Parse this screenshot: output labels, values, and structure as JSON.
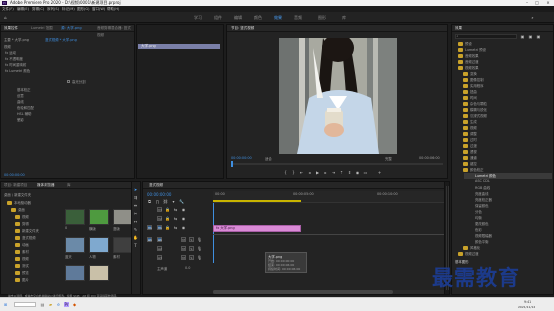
{
  "title_bar": {
    "title": "Adobe Premiere Pro 2020 - D:\\视频\\0001\\新建项目.prproj"
  },
  "menu": [
    "文件(F)",
    "编辑(E)",
    "剪辑(C)",
    "序列(S)",
    "标记(M)",
    "图形(G)",
    "窗口(W)",
    "帮助(H)"
  ],
  "workspaces": [
    {
      "label": "学习"
    },
    {
      "label": "组件"
    },
    {
      "label": "编辑",
      "active": true
    },
    {
      "label": "颜色"
    },
    {
      "label": "效果"
    },
    {
      "label": "音频"
    },
    {
      "label": "图形"
    },
    {
      "label": "库"
    }
  ],
  "effect_controls": {
    "tabs": [
      "效果控件",
      "Lumetri 范围",
      "源: 大学.png",
      "音频剪辑混合器: 竖式视频"
    ],
    "source_line": "主要 * 大学.png",
    "sequence_line": "竖式视频 * 大学.png",
    "section": "视频",
    "items": [
      "fx 运动",
      "fx 不透明度",
      "fx 时间重映射",
      "fx Lumetri 颜色",
      "基本校正",
      "创意",
      "曲线",
      "色轮和匹配",
      "HSL 辅助",
      "晕影"
    ],
    "checkbox_label": "高光分割",
    "time": "00:00:00:00"
  },
  "clip_chip": {
    "label": "大学.png"
  },
  "program": {
    "tab": "节目: 竖式视频",
    "timecode_left": "00:00:00:00",
    "fit": "适合",
    "quality": "完整",
    "timecode_right": "00:00:06:00"
  },
  "project": {
    "tabs": [
      "项目: 新建项目",
      "媒体浏览器",
      "库"
    ],
    "path": "桌面 \\ 新建文件夹",
    "tree": [
      "本地驱动器",
      "桌面",
      "视频",
      "剪辑",
      "新建文件夹",
      "竖式视频",
      "动画",
      "素材",
      "视频",
      "测试",
      "预览",
      "图片"
    ],
    "thumb_labels": [
      "0",
      "横版",
      "竖版",
      "蓝天",
      "人物",
      "素材"
    ]
  },
  "timeline": {
    "tab": "竖式视频",
    "timecode": "00:00:00:00",
    "ruler": [
      "00:00",
      "00:00:05:00",
      "00:00:10:00"
    ],
    "tracks": [
      "V3",
      "V2",
      "V1",
      "A1",
      "A2",
      "A3"
    ],
    "master": "主声道",
    "master_value": "0.0",
    "clip": "fx 大学.png",
    "tooltip": {
      "name": "大学.png",
      "start": "开始: 00:00:00:00",
      "end": "结束: 00:00:06:00",
      "duration": "持续时间: 00:00:06:00"
    }
  },
  "effects": {
    "tab": "效果",
    "items": [
      "预设",
      "Lumetri 预设",
      "音频效果",
      "音频过渡",
      "视频效果",
      "变换",
      "图像控制",
      "实用程序",
      "扭曲",
      "时间",
      "杂色与颗粒",
      "模糊与锐化",
      "沉浸式视频",
      "生成",
      "视频",
      "调整",
      "过时",
      "过渡",
      "透视",
      "通道",
      "键控",
      "颜色校正",
      "Lumetri 颜色",
      "ASC CDL",
      "RGB 曲线",
      "亮度曲线",
      "亮度校正器",
      "保留颜色",
      "分色",
      "均衡",
      "更改颜色",
      "色彩",
      "视频限幅器",
      "颜色平衡",
      "风格化",
      "视频过渡"
    ],
    "highlight": "Lumetri 颜色",
    "footer": "基本图形"
  },
  "watermark": "最需教育",
  "status": "单击以选择，或单击空白处并拖动以进行框选。使用 Shift、Alt 和 Ctrl 可获得其他选项。",
  "taskbar": {
    "time": "9:41",
    "date": "2021/11/12"
  },
  "colors": {
    "accent": "#3f8fe0",
    "clip": "#d98ad6",
    "folder": "#c9a22a",
    "watermark": "#1c3a8a"
  }
}
